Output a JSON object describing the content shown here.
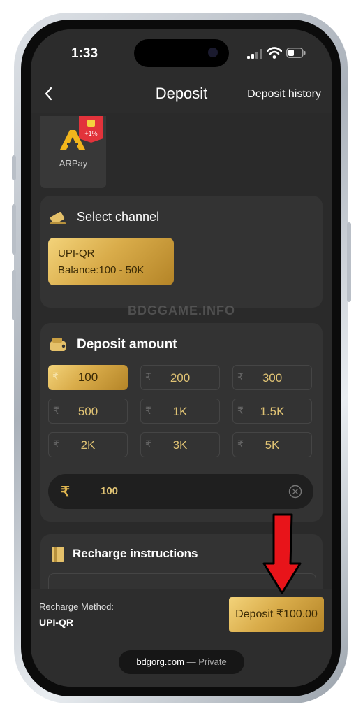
{
  "status_bar": {
    "time": "1:33"
  },
  "header": {
    "back_icon": "chevron-left-icon",
    "title": "Deposit",
    "history_label": "Deposit history"
  },
  "payment_method": {
    "name": "ARPay",
    "badge": "+1%"
  },
  "channel_section": {
    "title": "Select channel",
    "channel": {
      "name": "UPI-QR",
      "balance": "Balance:100 - 50K"
    }
  },
  "watermark": "BDGGAME.INFO",
  "amount_section": {
    "title": "Deposit amount",
    "currency_symbol": "₹",
    "options": [
      "100",
      "200",
      "300",
      "500",
      "1K",
      "1.5K",
      "2K",
      "3K",
      "5K"
    ],
    "selected_index": 0,
    "input_value": "100"
  },
  "instructions_section": {
    "title": "Recharge instructions"
  },
  "footer": {
    "method_label": "Recharge Method:",
    "method_value": "UPI-QR",
    "deposit_button": "Deposit ₹100.00"
  },
  "browser_bar": {
    "domain": "bdgorg.com",
    "mode": " — Private"
  },
  "colors": {
    "gold": "#d9ac4a",
    "background": "#2a2a2a",
    "card": "#333333",
    "arrow": "#e8141a"
  }
}
